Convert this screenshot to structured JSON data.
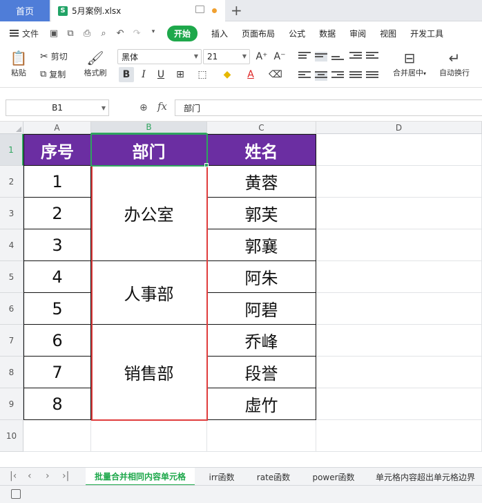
{
  "tabs": {
    "home": "首页",
    "file_icon": "S",
    "file_name": "5月案例.xlsx",
    "add": "+"
  },
  "menu": {
    "file": "文件",
    "items": [
      "开始",
      "插入",
      "页面布局",
      "公式",
      "数据",
      "审阅",
      "视图",
      "开发工具"
    ]
  },
  "ribbon": {
    "paste": "粘贴",
    "cut": "剪切",
    "copy": "复制",
    "format_painter": "格式刷",
    "font_name": "黑体",
    "font_size": "21",
    "bold": "B",
    "italic": "I",
    "underline": "U",
    "merge_center": "合并居中",
    "wrap_text": "自动换行"
  },
  "formula_bar": {
    "cell_ref": "B1",
    "fx": "fx",
    "value": "部门"
  },
  "columns": [
    "A",
    "B",
    "C",
    "D"
  ],
  "rows": [
    "1",
    "2",
    "3",
    "4",
    "5",
    "6",
    "7",
    "8",
    "9",
    "10"
  ],
  "table": {
    "headers": [
      "序号",
      "部门",
      "姓名"
    ],
    "numbers": [
      "1",
      "2",
      "3",
      "4",
      "5",
      "6",
      "7",
      "8"
    ],
    "departments": [
      "办公室",
      "人事部",
      "销售部"
    ],
    "names": [
      "黄蓉",
      "郭芙",
      "郭襄",
      "阿朱",
      "阿碧",
      "乔峰",
      "段誉",
      "虚竹"
    ]
  },
  "sheets": [
    "批量合并相同内容单元格",
    "irr函数",
    "rate函数",
    "power函数",
    "单元格内容超出单元格边界"
  ],
  "colors": {
    "header_fill": "#6b2ea2",
    "selection": "#2fa55f",
    "highlight_box": "#e03c3c",
    "accent": "#1ea84b"
  }
}
